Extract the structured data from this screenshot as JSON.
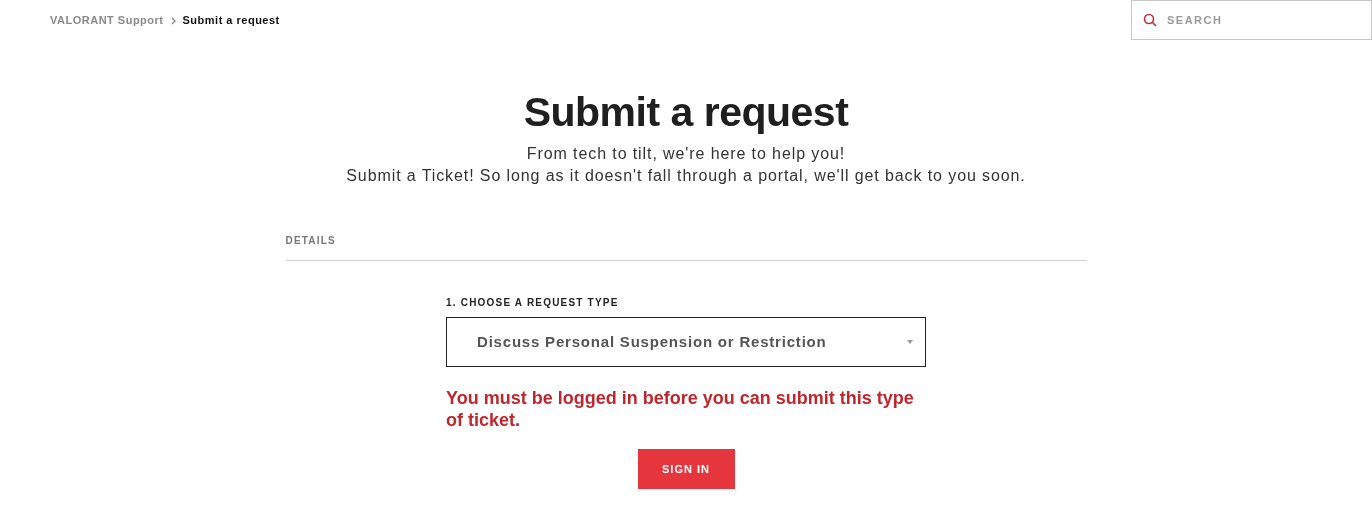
{
  "breadcrumb": [
    {
      "label": "VALORANT Support",
      "current": false
    },
    {
      "label": "Submit a request",
      "current": true
    }
  ],
  "search": {
    "placeholder": "SEARCH"
  },
  "title": "Submit a request",
  "subtitle_lines": [
    "From tech to tilt, we're here to help you!",
    "Submit a Ticket! So long as it doesn't fall through a portal, we'll get back to you soon."
  ],
  "section": "DETAILS",
  "request_type": {
    "label": "1. CHOOSE A REQUEST TYPE",
    "value": "Discuss Personal Suspension or Restriction"
  },
  "error": "You must be logged in before you can submit this type of ticket.",
  "sign_in_button": "SIGN IN"
}
